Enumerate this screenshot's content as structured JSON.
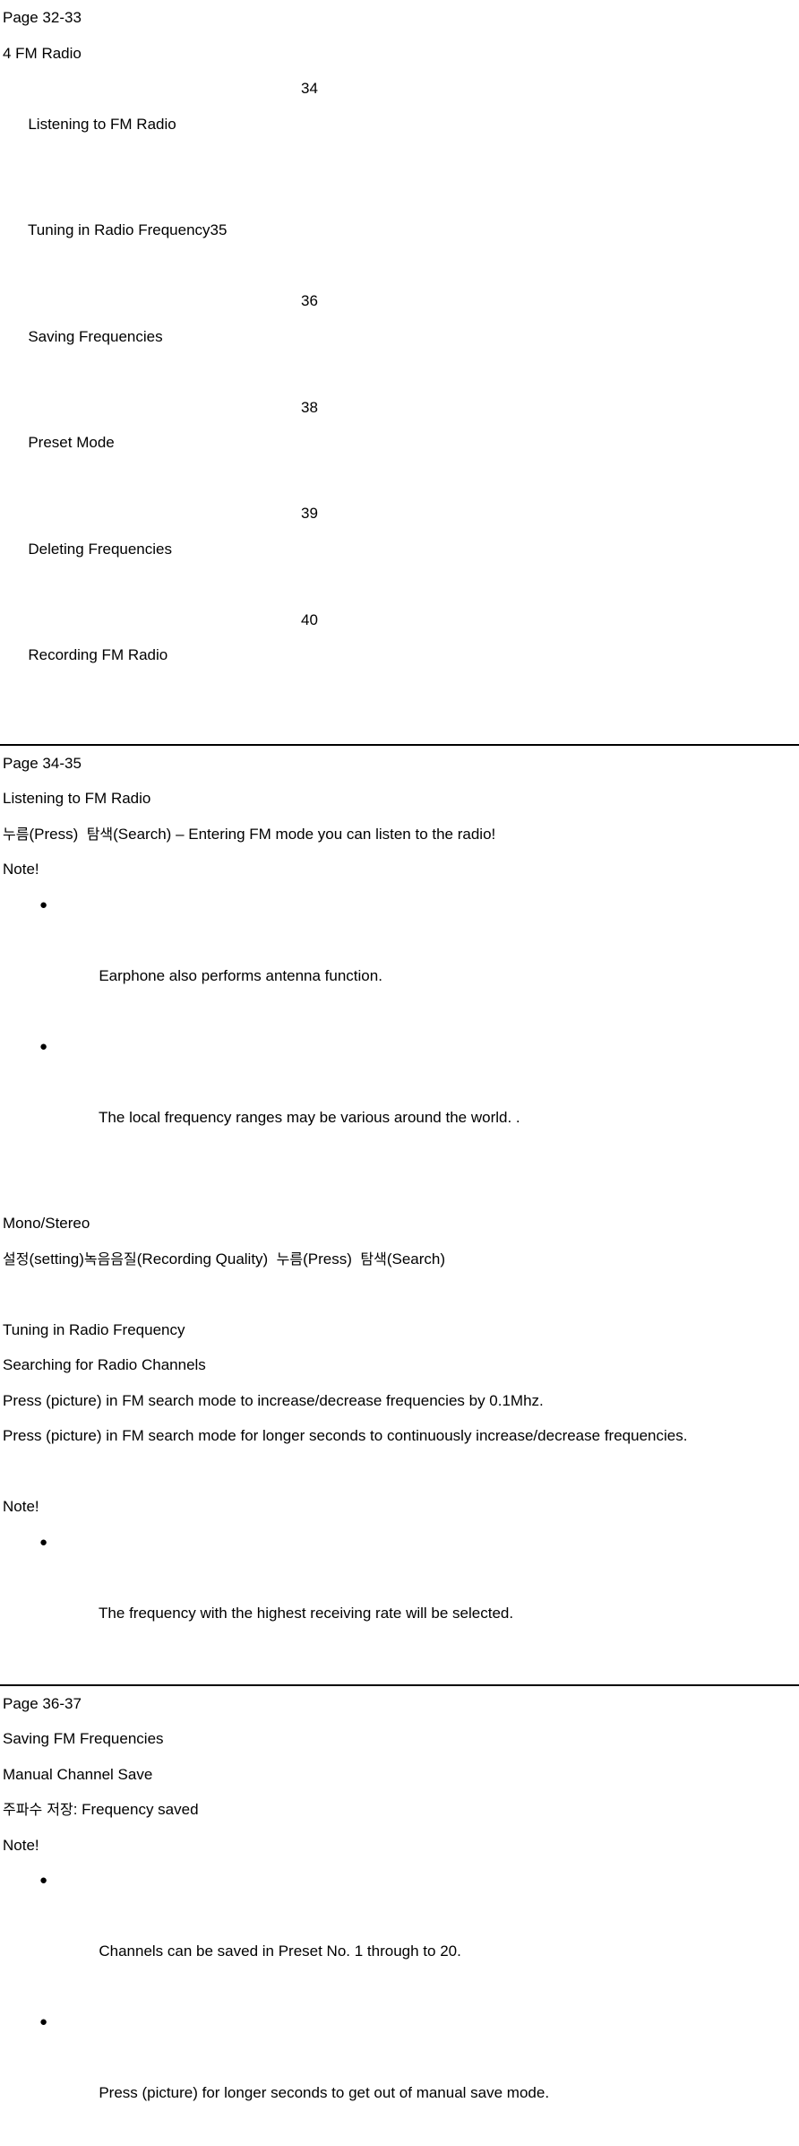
{
  "document": {
    "sections": [
      {
        "id": "toc-32-33",
        "page_label": "Page 32-33",
        "chapter_heading": "4 FM Radio",
        "toc_entries": [
          {
            "title": "Listening to FM Radio",
            "page": "34",
            "tabbed": true
          },
          {
            "title": "Tuning in Radio Frequency",
            "page": "35",
            "tabbed": false
          },
          {
            "title": "Saving Frequencies",
            "page": "36",
            "tabbed": true
          },
          {
            "title": "Preset Mode",
            "page": "38",
            "tabbed": true
          },
          {
            "title": "Deleting Frequencies",
            "page": "39",
            "tabbed": true
          },
          {
            "title": "Recording FM Radio",
            "page": "40",
            "tabbed": true
          }
        ]
      },
      {
        "id": "body-34-35",
        "page_label": "Page 34-35",
        "heading_listening": "Listening to FM Radio",
        "press_search_line": {
          "kr_press": "누름",
          "en_press": "(Press)",
          "kr_search": "탐색",
          "en_search": "(Search)",
          "description": "– Entering FM mode you can listen to the radio!"
        },
        "note_label_1": "Note!",
        "notes_1": [
          "Earphone also performs antenna function.",
          "The local frequency ranges may be various around the world. ."
        ],
        "heading_mono_stereo": "Mono/Stereo",
        "mono_stereo_line": {
          "kr_setting": "설정",
          "en_setting": "(setting)",
          "kr_recording_quality": "녹음음질",
          "en_recording_quality": "(Recording Quality)",
          "kr_press": "누름",
          "en_press": "(Press)",
          "kr_search": "탐색",
          "en_search": "(Search)"
        },
        "heading_tuning": "Tuning in Radio Frequency",
        "heading_searching": "Searching for Radio Channels",
        "paragraph_1": "Press (picture) in FM search mode to increase/decrease frequencies by 0.1Mhz.",
        "paragraph_2": "Press (picture) in FM search mode for longer seconds to continuously increase/decrease frequencies.",
        "note_label_2": "Note!",
        "notes_2": [
          "The frequency with the highest receiving rate will be selected."
        ]
      },
      {
        "id": "body-36-37",
        "page_label": "Page 36-37",
        "heading_saving": "Saving FM Frequencies",
        "heading_manual": "Manual Channel Save",
        "frequency_saved_line": {
          "kr_frequency_saved": "주파수 저장",
          "en_frequency_saved": ": Frequency saved"
        },
        "note_label_3": "Note!",
        "notes_3": [
          "Channels can be saved in Preset No. 1 through to 20.",
          "Press (picture) for longer seconds to get out of manual save mode."
        ]
      }
    ],
    "bullet_glyph": "●"
  }
}
